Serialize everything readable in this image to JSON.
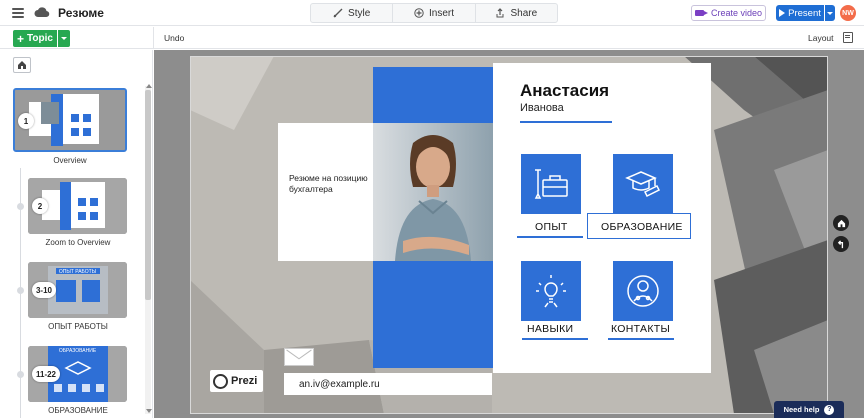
{
  "header": {
    "title": "Резюме",
    "tabs": [
      {
        "label": "Style",
        "icon": "brush-icon"
      },
      {
        "label": "Insert",
        "icon": "plus-icon"
      },
      {
        "label": "Share",
        "icon": "share-icon"
      }
    ],
    "create_video": "Create video",
    "present": "Present",
    "avatar_initials": "NW"
  },
  "toolbar": {
    "topic": "Topic",
    "undo": "Undo",
    "layout": "Layout"
  },
  "sidebar": {
    "items": [
      {
        "badge": "1",
        "label": "Overview",
        "active": true
      },
      {
        "badge": "2",
        "label": "Zoom to Overview",
        "active": false
      },
      {
        "badge": "3-10",
        "label": "ОПЫТ РАБОТЫ",
        "active": false,
        "thumb_title": "ОПЫТ РАБОТЫ"
      },
      {
        "badge": "11-22",
        "label": "ОБРАЗОВАНИЕ",
        "active": false,
        "thumb_title": "ОБРАЗОВАНИЕ"
      }
    ]
  },
  "slide": {
    "first_name": "Анастасия",
    "last_name": "Иванова",
    "intro": "Резюме на позицию бухгалтера",
    "sections": [
      {
        "label": "ОПЫТ",
        "icon": "toolbox-icon"
      },
      {
        "label": "ОБРАЗОВАНИЕ",
        "icon": "graduation-cap-icon"
      },
      {
        "label": "НАВЫКИ",
        "icon": "lightbulb-icon"
      },
      {
        "label": "КОНТАКТЫ",
        "icon": "contact-icon"
      }
    ],
    "email": "an.iv@example.ru",
    "logo": "Prezi"
  },
  "help": {
    "label": "Need help",
    "q": "?"
  },
  "colors": {
    "accent": "#2e6fd6",
    "present": "#1f6ed4",
    "topic": "#27a851",
    "avatar": "#f36c4a",
    "help": "#1b2c59"
  }
}
